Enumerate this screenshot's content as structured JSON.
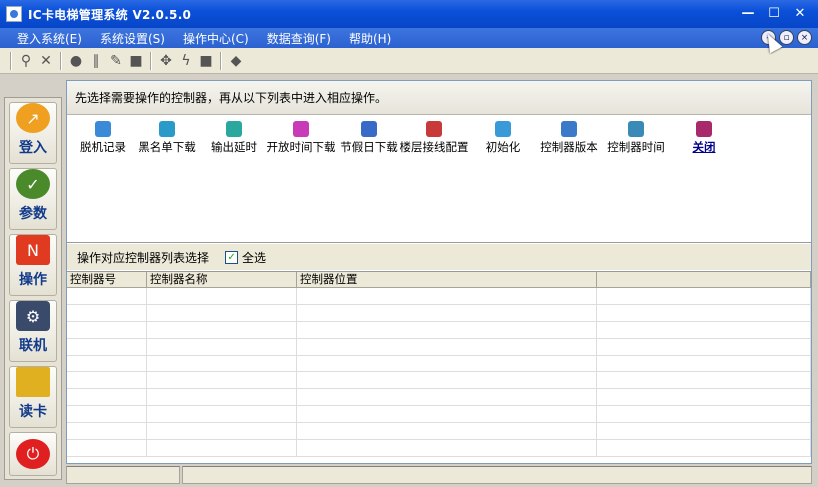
{
  "window": {
    "title": "IC卡电梯管理系统  V2.0.5.0",
    "controls": [
      "minimize-icon",
      "maximize-icon",
      "close-icon"
    ]
  },
  "menu": {
    "items": [
      {
        "label": "登入系统(E)"
      },
      {
        "label": "系统设置(S)"
      },
      {
        "label": "操作中心(C)"
      },
      {
        "label": "数据查询(F)"
      },
      {
        "label": "帮助(H)"
      }
    ]
  },
  "toolbar": {
    "icons": [
      "search-icon",
      "close-icon",
      "record-icon",
      "clip-icon",
      "pin-icon",
      "stop-icon",
      "gear-icon",
      "lightning-icon",
      "square-icon",
      "tag-icon"
    ]
  },
  "sidebar": {
    "items": [
      {
        "label": "登入",
        "icon": "login-icon",
        "color": "#f0a020"
      },
      {
        "label": "参数",
        "icon": "params-icon",
        "color": "#4a8a2a"
      },
      {
        "label": "操作",
        "icon": "new-icon",
        "color": "#e03a20"
      },
      {
        "label": "联机",
        "icon": "connect-icon",
        "color": "#3a4a6a"
      },
      {
        "label": "读卡",
        "icon": "card-icon",
        "color": "#e0b020"
      },
      {
        "label": "",
        "icon": "power-icon",
        "color": "#e02020"
      }
    ]
  },
  "hint": "先选择需要操作的控制器，再从以下列表中进入相应操作。",
  "operations": [
    {
      "label": "脱机记录",
      "icon": "offline-record-icon",
      "color": "#3a8ad8"
    },
    {
      "label": "黑名单下载",
      "icon": "blacklist-download-icon",
      "color": "#2a9ac8"
    },
    {
      "label": "输出延时",
      "icon": "output-delay-icon",
      "color": "#2aa8a0"
    },
    {
      "label": "开放时间下载",
      "icon": "open-time-download-icon",
      "color": "#c83ab8"
    },
    {
      "label": "节假日下载",
      "icon": "holiday-download-icon",
      "color": "#3a6ac8"
    },
    {
      "label": "楼层接线配置",
      "icon": "floor-wiring-icon",
      "color": "#c83a3a"
    },
    {
      "label": "初始化",
      "icon": "initialize-icon",
      "color": "#3a9ad8"
    },
    {
      "label": "控制器版本",
      "icon": "controller-version-icon",
      "color": "#3a7ac8"
    },
    {
      "label": "控制器时间",
      "icon": "controller-time-icon",
      "color": "#3a8ab8"
    },
    {
      "label": "关闭",
      "icon": "close-op-icon",
      "color": "#a82a6a"
    }
  ],
  "selection": {
    "label": "操作对应控制器列表选择",
    "select_all": "全选",
    "select_all_checked": true
  },
  "table": {
    "columns": [
      "控制器号",
      "控制器名称",
      "控制器位置",
      ""
    ],
    "rows": []
  }
}
